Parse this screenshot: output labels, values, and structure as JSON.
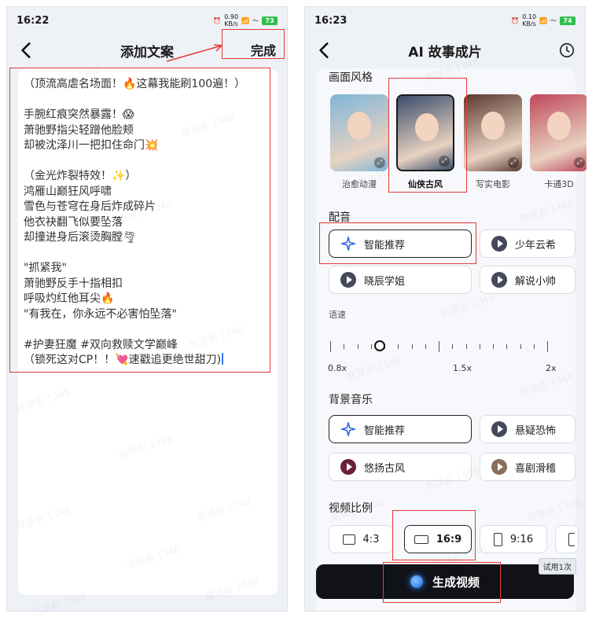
{
  "left": {
    "status": {
      "time": "16:22",
      "speed_value": "0.90",
      "speed_unit": "KB/s",
      "battery": "73"
    },
    "title": "添加文案",
    "done_label": "完成",
    "script_lines": [
      "（顶流高虐名场面！🔥这幕我能刷100遍！）",
      "",
      "手腕红痕突然暴露！😱",
      "萧驰野指尖轻蹭他脸颊",
      "却被沈泽川一把扣住命门💥",
      "",
      "（金光炸裂特效！✨）",
      "鸿雁山巅狂风呼啸",
      "雪色与苍穹在身后炸成碎片",
      "他衣袂翻飞似要坠落",
      "却撞进身后滚烫胸膛🌪",
      "",
      "\"抓紧我\"",
      "萧驰野反手十指相扣",
      "呼吸灼红他耳尖🔥",
      "\"有我在，你永远不必害怕坠落\"",
      "",
      "#护妻狂魔 #双向救赎文学巅峰",
      "（锁死这对CP！！💘速戳追更绝世甜刀)"
    ]
  },
  "right": {
    "status": {
      "time": "16:23",
      "speed_value": "0.10",
      "speed_unit": "KB/s",
      "battery": "74"
    },
    "title": "AI 故事成片",
    "style_section": "画面风格",
    "styles": [
      {
        "label": "治愈动漫",
        "color": "#7fb6d8"
      },
      {
        "label": "仙侠古风",
        "color": "#3b4d6b"
      },
      {
        "label": "写实电影",
        "color": "#5a3a2e"
      },
      {
        "label": "卡通3D",
        "color": "#c0485a"
      }
    ],
    "voice_section": "配音",
    "voices": [
      "智能推荐",
      "少年云希",
      "晓辰学姐",
      "解说小帅"
    ],
    "speed_section": "语速",
    "speed_marks": [
      "0.8x",
      "1.5x",
      "2x"
    ],
    "speed_value": 0.2,
    "music_section": "背景音乐",
    "music": [
      "智能推荐",
      "悬疑恐怖",
      "悠扬古风",
      "喜剧滑稽"
    ],
    "ratio_section": "视频比例",
    "ratios": [
      "4:3",
      "16:9",
      "9:16"
    ],
    "generate_label": "生成视频",
    "trial_badge": "试用1次"
  },
  "watermark": "陈慧俞 1348",
  "accent": "#e53935"
}
